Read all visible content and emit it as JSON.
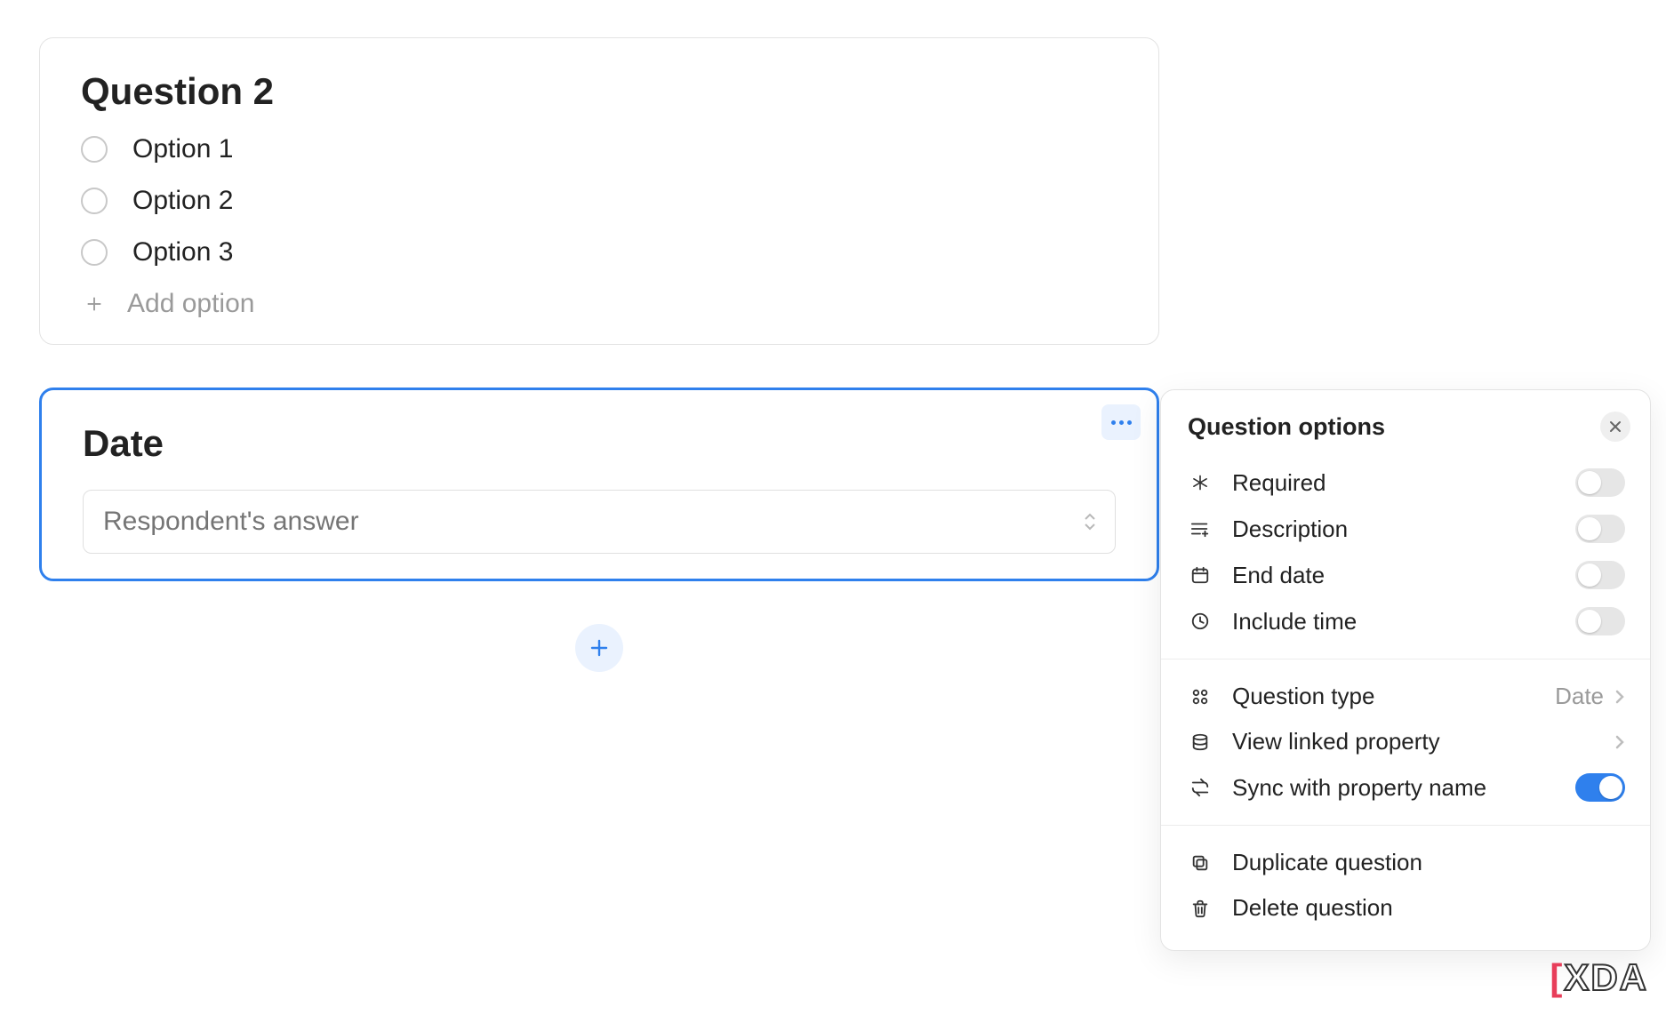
{
  "question2": {
    "title": "Question 2",
    "options": [
      "Option 1",
      "Option 2",
      "Option 3"
    ],
    "add_option_label": "Add option"
  },
  "date_question": {
    "title": "Date",
    "placeholder": "Respondent's answer"
  },
  "popover": {
    "title": "Question options",
    "section1": {
      "required": {
        "label": "Required",
        "value": false
      },
      "description": {
        "label": "Description",
        "value": false
      },
      "end_date": {
        "label": "End date",
        "value": false
      },
      "include_time": {
        "label": "Include time",
        "value": false
      }
    },
    "section2": {
      "question_type": {
        "label": "Question type",
        "value": "Date"
      },
      "view_linked": {
        "label": "View linked property"
      },
      "sync": {
        "label": "Sync with property name",
        "value": true
      }
    },
    "section3": {
      "duplicate": "Duplicate question",
      "delete": "Delete question"
    }
  },
  "watermark": "XDA"
}
